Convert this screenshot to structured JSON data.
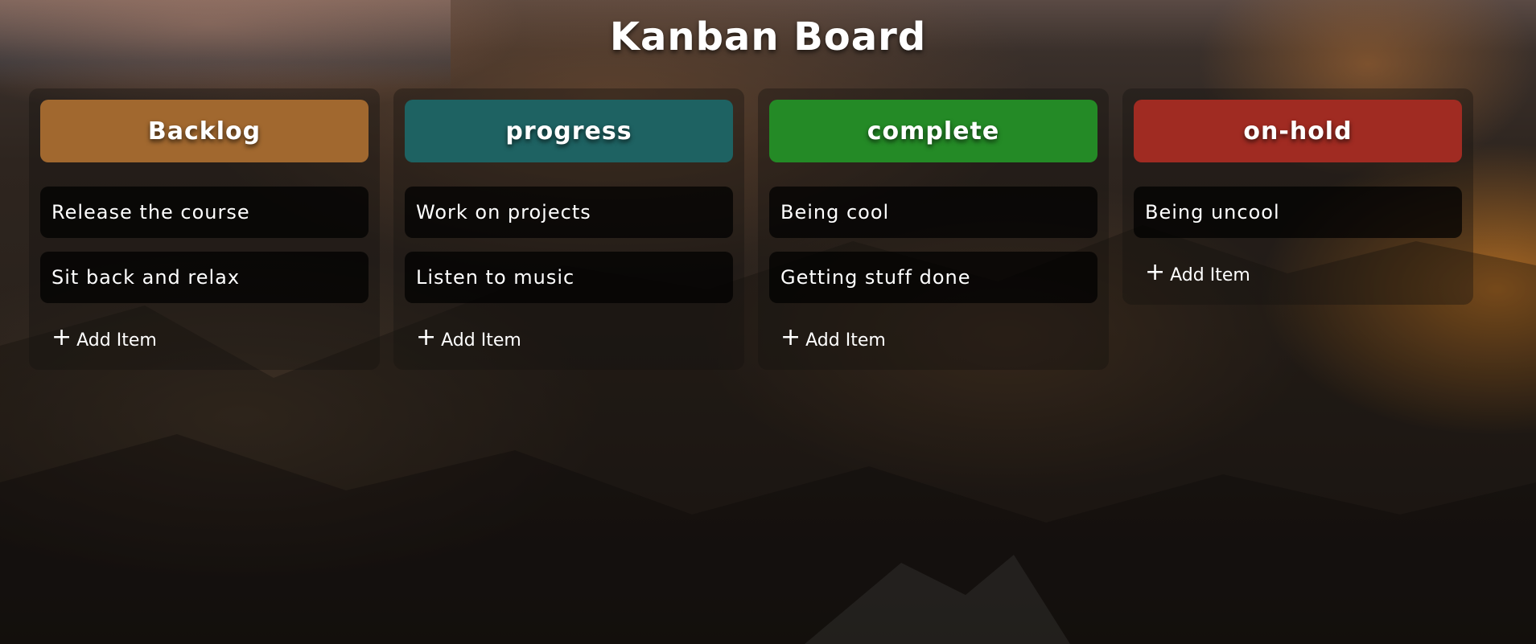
{
  "board": {
    "title": "Kanban Board",
    "add_label": "Add Item",
    "add_icon": "+"
  },
  "columns": [
    {
      "name": "Backlog",
      "color": "#a1682f",
      "items": [
        "Release the course",
        "Sit back and relax"
      ]
    },
    {
      "name": "progress",
      "color": "#1e6262",
      "items": [
        "Work on projects",
        "Listen to music"
      ]
    },
    {
      "name": "complete",
      "color": "#248a26",
      "items": [
        "Being cool",
        "Getting stuff done"
      ]
    },
    {
      "name": "on-hold",
      "color": "#a02b22",
      "items": [
        "Being uncool"
      ]
    }
  ]
}
